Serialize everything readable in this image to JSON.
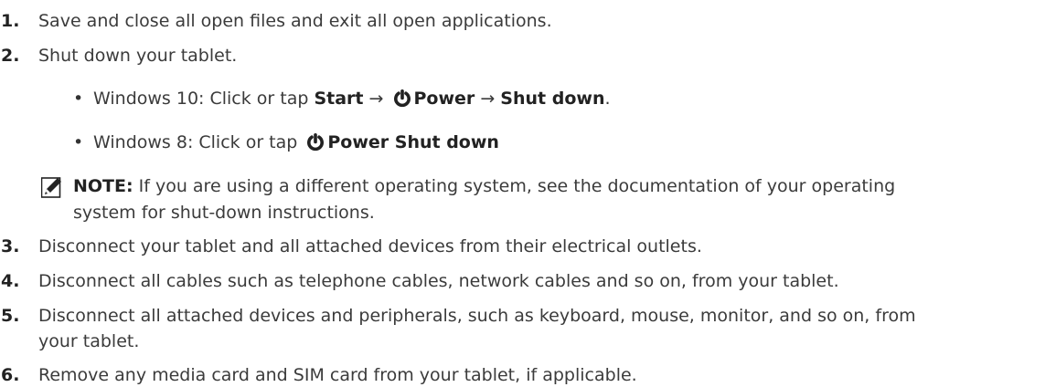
{
  "steps": [
    {
      "num": "1.",
      "text": "Save and close all open files and exit all open applications."
    },
    {
      "num": "2.",
      "text": "Shut down your tablet."
    },
    {
      "num": "3.",
      "text": "Disconnect your tablet and all attached devices from their electrical outlets."
    },
    {
      "num": "4.",
      "text": "Disconnect all cables such as telephone cables, network cables and so on, from your tablet."
    },
    {
      "num": "5.",
      "text_line1": "Disconnect all attached devices and peripherals, such as keyboard, mouse, monitor, and so on, from",
      "text_line2": "your tablet."
    },
    {
      "num": "6.",
      "text": "Remove any media card and SIM card from your tablet, if applicable."
    }
  ],
  "sub_steps": {
    "win10": {
      "bullet": "•",
      "prefix": "Windows 10: Click or tap ",
      "start": "Start",
      "arrow1": " → ",
      "power": "Power",
      "arrow2": " → ",
      "shutdown": "Shut down",
      "suffix": ".",
      "power_icon": "power-icon"
    },
    "win8": {
      "bullet": "•",
      "prefix": "Windows 8: Click or tap ",
      "power_shutdown": "Power Shut down",
      "power_icon": "power-icon"
    }
  },
  "note": {
    "icon": "pencil-note-icon",
    "label": "NOTE:",
    "line1": " If you are using a different operating system, see the documentation of your operating",
    "line2": "system for shut-down instructions."
  }
}
